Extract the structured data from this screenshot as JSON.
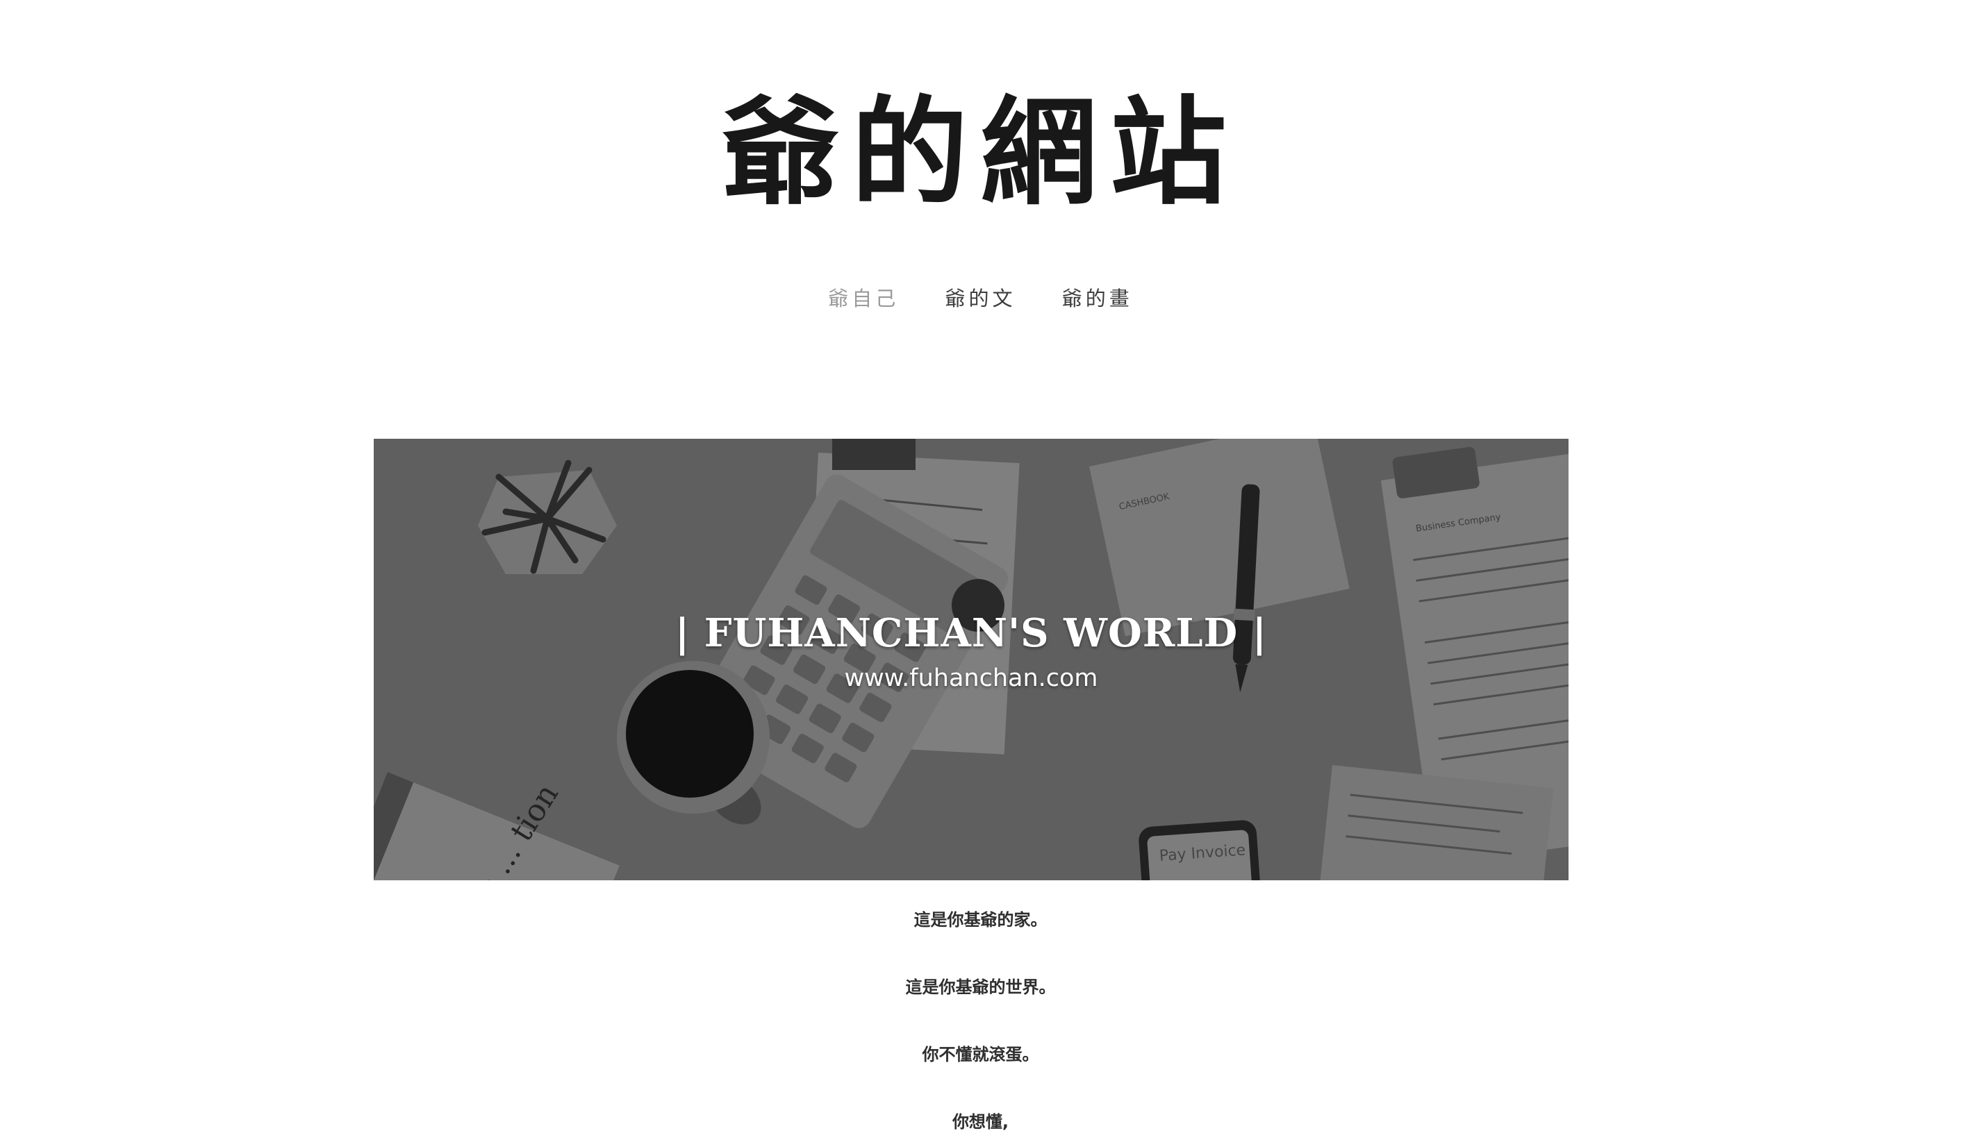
{
  "site": {
    "title": "爺的網站"
  },
  "nav": {
    "items": [
      {
        "label": "爺自己",
        "active": true
      },
      {
        "label": "爺的文",
        "active": false
      },
      {
        "label": "爺的畫",
        "active": false
      }
    ]
  },
  "hero": {
    "title": "| FUHANCHAN'S WORLD |",
    "url": "www.fuhanchan.com",
    "embedded_text": {
      "notebook": "CASHBOOK",
      "phone": "Pay Invoice",
      "invoice": "Business Company",
      "book": "the ... tion"
    }
  },
  "intro": {
    "lines": [
      "這是你基爺的家。",
      "這是你基爺的世界。",
      "你不懂就滾蛋。",
      "你想懂,"
    ]
  },
  "colors": {
    "title": "#181818",
    "nav_active": "#9a9a9a",
    "nav": "#3c3c3c",
    "body_text": "#2e2e2e",
    "hero_bg": "#777777"
  }
}
